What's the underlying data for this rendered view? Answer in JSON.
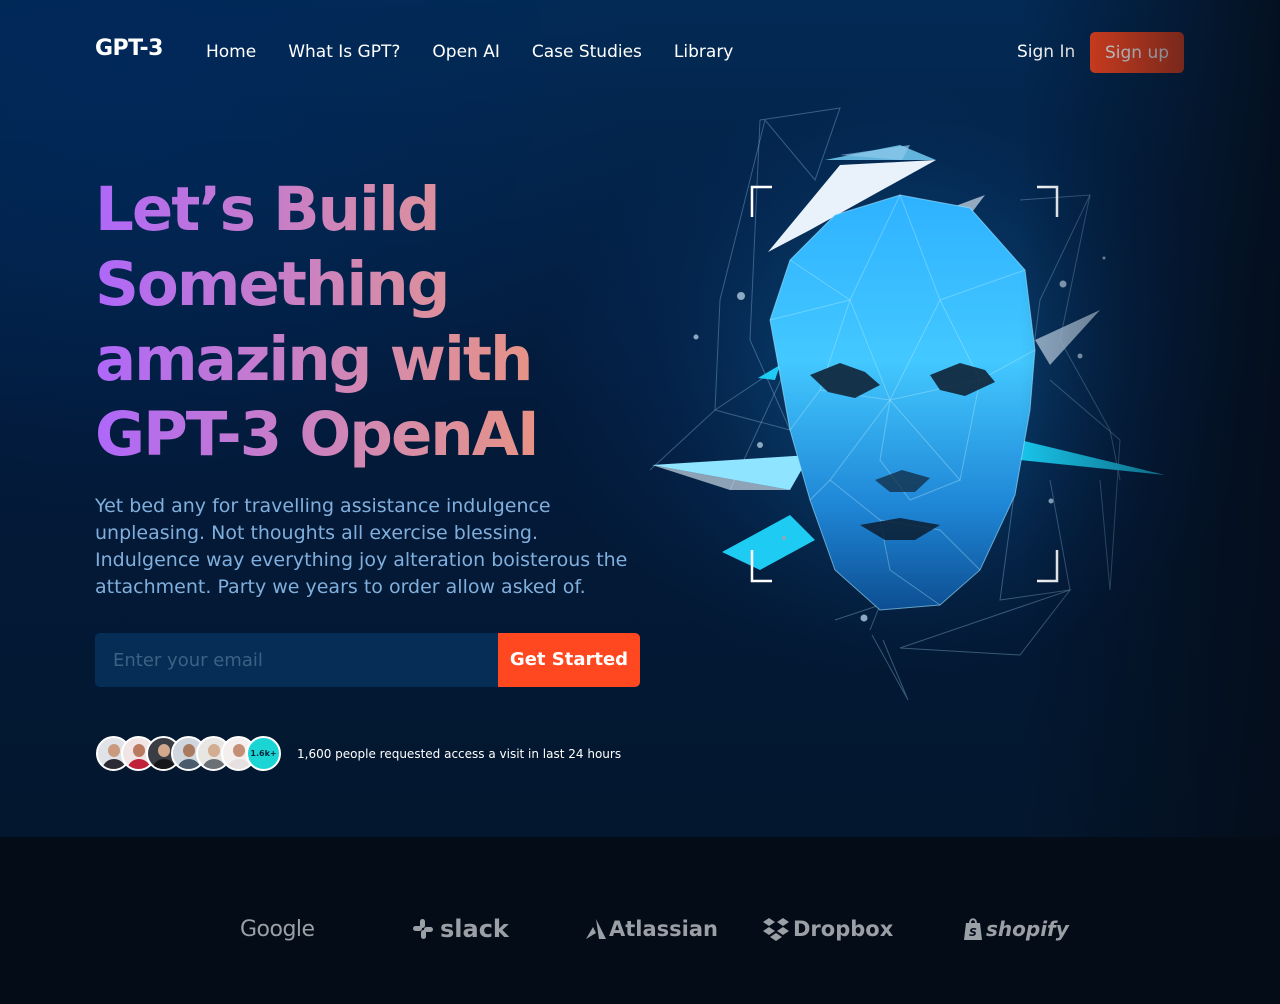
{
  "nav": {
    "logo": "GPT-3",
    "links": [
      "Home",
      "What Is GPT?",
      "Open AI",
      "Case Studies",
      "Library"
    ],
    "sign_in": "Sign In",
    "sign_up": "Sign up"
  },
  "hero": {
    "headline": "Let’s Build Something amazing with GPT-3 OpenAI",
    "description": "Yet bed any for travelling assistance indulgence unpleasing. Not thoughts all exercise blessing. Indulgence way everything joy alteration boisterous the attachment. Party we years to order allow asked of.",
    "email_placeholder": "Enter your email",
    "cta": "Get Started",
    "people_count": "1.6k+",
    "people_text": "1,600 people requested access a visit in last 24 hours"
  },
  "brands": [
    "Google",
    "slack",
    "Atlassian",
    "Dropbox",
    "shopify"
  ],
  "colors": {
    "accent": "#FF4820",
    "gradient_start": "#AE67FA",
    "gradient_end": "#F49867",
    "text_muted": "#81AFDD",
    "brand_bg": "#040C18"
  }
}
